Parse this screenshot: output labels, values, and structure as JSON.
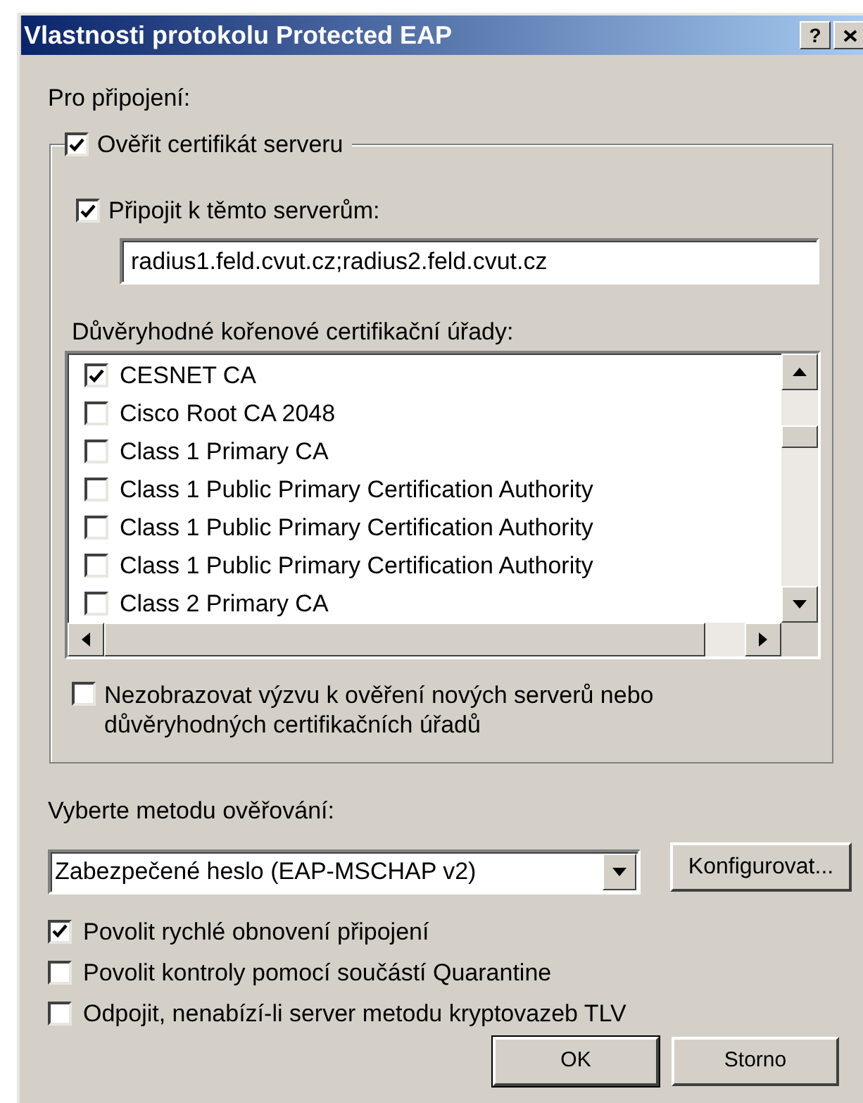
{
  "window": {
    "title": "Vlastnosti protokolu Protected EAP",
    "help_button": "?"
  },
  "connection_label": "Pro připojení:",
  "verify_server": {
    "label": "Ověřit certifikát serveru",
    "checked": true
  },
  "connect_to_servers": {
    "label": "Připojit k těmto serverům:",
    "checked": true
  },
  "servers_field": {
    "value": "radius1.feld.cvut.cz;radius2.feld.cvut.cz"
  },
  "trusted_ca_label": "Důvěryhodné kořenové certifikační úřady:",
  "trusted_ca_list": [
    {
      "label": "CESNET CA",
      "checked": true
    },
    {
      "label": "Cisco Root CA 2048",
      "checked": false
    },
    {
      "label": "Class 1 Primary CA",
      "checked": false
    },
    {
      "label": "Class 1 Public Primary Certification Authority",
      "checked": false
    },
    {
      "label": "Class 1 Public Primary Certification Authority",
      "checked": false
    },
    {
      "label": "Class 1 Public Primary Certification Authority",
      "checked": false
    },
    {
      "label": "Class 2 Primary CA",
      "checked": false
    }
  ],
  "no_prompt": {
    "label": "Nezobrazovat výzvu k ověření nových serverů nebo důvěryhodných certifikačních úřadů",
    "checked": false
  },
  "method_label": "Vyberte metodu ověřování:",
  "method_select": {
    "value": "Zabezpečené heslo (EAP-MSCHAP v2)"
  },
  "configure_button": "Konfigurovat...",
  "options": [
    {
      "label": "Povolit rychlé obnovení připojení",
      "checked": true
    },
    {
      "label": "Povolit kontroly pomocí součástí Quarantine",
      "checked": false
    },
    {
      "label": "Odpojit, nenabízí-li server metodu kryptovazeb TLV",
      "checked": false
    }
  ],
  "buttons": [
    "OK",
    "Storno"
  ]
}
